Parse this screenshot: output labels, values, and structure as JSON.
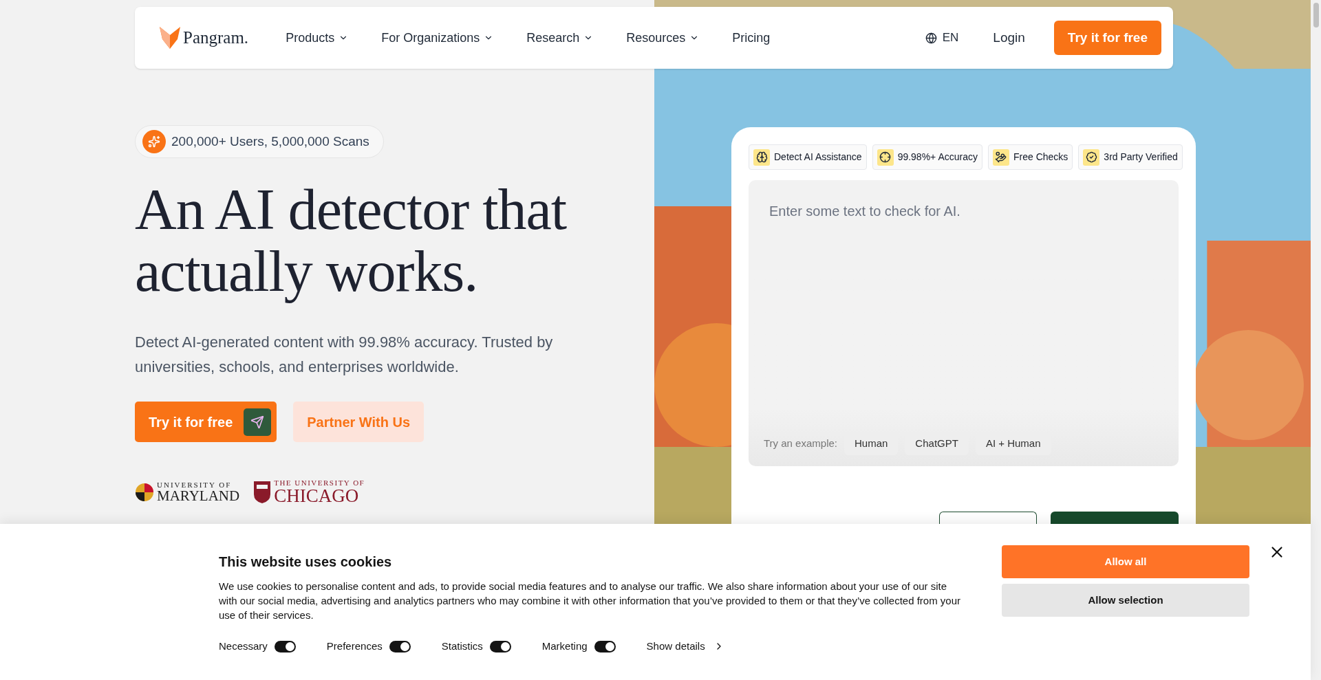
{
  "nav": {
    "logo": "Pangram.",
    "items": [
      {
        "label": "Products",
        "has_menu": true
      },
      {
        "label": "For Organizations",
        "has_menu": true
      },
      {
        "label": "Research",
        "has_menu": true
      },
      {
        "label": "Resources",
        "has_menu": true
      },
      {
        "label": "Pricing",
        "has_menu": false
      }
    ],
    "language": "EN",
    "login": "Login",
    "cta": "Try it for free"
  },
  "hero": {
    "badge": "200,000+ Users, 5,000,000 Scans",
    "headline": [
      "An AI detector that",
      "actually works."
    ],
    "subtitle": "Detect AI-generated content with 99.98% accuracy. Trusted by universities, schools, and enterprises worldwide.",
    "primary_button": "Try it for free",
    "secondary_button": "Partner With Us",
    "logos": [
      {
        "kind": "maryland",
        "top": "UNIVERSITY OF",
        "name": "MARYLAND"
      },
      {
        "kind": "chicago",
        "top": "THE UNIVERSITY OF",
        "name": "CHICAGO"
      }
    ]
  },
  "detector": {
    "features": [
      {
        "kind": "brain",
        "label": "Detect AI Assistance"
      },
      {
        "kind": "target",
        "label": "99.98%+ Accuracy"
      },
      {
        "kind": "hand",
        "label": "Free Checks"
      },
      {
        "kind": "verified",
        "label": "3rd Party Verified"
      }
    ],
    "placeholder": "Enter some text to check for AI.",
    "examples_label": "Try an example:",
    "examples": [
      "Human",
      "ChatGPT",
      "AI + Human"
    ]
  },
  "cookie_banner": {
    "title": "This website uses cookies",
    "text": "We use cookies to personalise content and ads, to provide social media features and to analyse our traffic. We also share information about your use of our site with our social media, advertising and analytics partners who may combine it with other information that you’ve provided to them or that they’ve collected from your use of their services.",
    "toggles": [
      {
        "label": "Necessary",
        "on": true
      },
      {
        "label": "Preferences",
        "on": true
      },
      {
        "label": "Statistics",
        "on": true
      },
      {
        "label": "Marketing",
        "on": true
      }
    ],
    "details": "Show details",
    "allow_all": "Allow all",
    "allow_selection": "Allow selection"
  }
}
